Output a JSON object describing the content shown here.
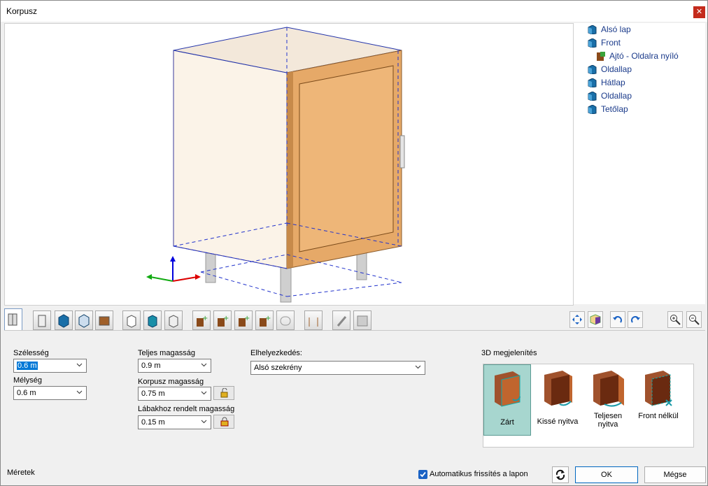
{
  "window": {
    "title": "Korpusz",
    "close_icon": "close-icon",
    "accent": "#c42b1c"
  },
  "tree": {
    "items": [
      {
        "label": "Alsó lap",
        "icon": "panel-icon",
        "level": 0
      },
      {
        "label": "Front",
        "icon": "panel-icon",
        "level": 0
      },
      {
        "label": "Ajtó - Oldalra nyíló",
        "icon": "door-icon",
        "level": 1
      },
      {
        "label": "Oldallap",
        "icon": "panel-icon",
        "level": 0
      },
      {
        "label": "Hátlap",
        "icon": "panel-icon",
        "level": 0
      },
      {
        "label": "Oldallap",
        "icon": "panel-icon",
        "level": 0
      },
      {
        "label": "Tetőlap",
        "icon": "panel-icon",
        "level": 0
      }
    ]
  },
  "form": {
    "width_label": "Szélesség",
    "width_value": "0.6 m",
    "depth_label": "Mélység",
    "depth_value": "0.6 m",
    "total_height_label": "Teljes magasság",
    "total_height_value": "0.9 m",
    "body_height_label": "Korpusz magasság",
    "body_height_value": "0.75 m",
    "leg_height_label": "Lábakhoz rendelt magasság",
    "leg_height_value": "0.15 m",
    "placement_label": "Elhelyezkedés:",
    "placement_value": "Alsó szekrény"
  },
  "view3d": {
    "label": "3D megjelenítés",
    "options": [
      {
        "label": "Zárt",
        "active": true
      },
      {
        "label": "Kissé nyitva",
        "active": false
      },
      {
        "label": "Teljesen nyitva",
        "active": false
      },
      {
        "label": "Front nélkül",
        "active": false
      }
    ]
  },
  "footer": {
    "section_label": "Méretek",
    "auto_refresh_label": "Automatikus frissítés a lapon",
    "auto_refresh_checked": true,
    "ok_label": "OK",
    "cancel_label": "Mégse"
  },
  "colors": {
    "door": "#e6a968",
    "body": "#fbf3e8",
    "selected": "#a7d6cf"
  }
}
